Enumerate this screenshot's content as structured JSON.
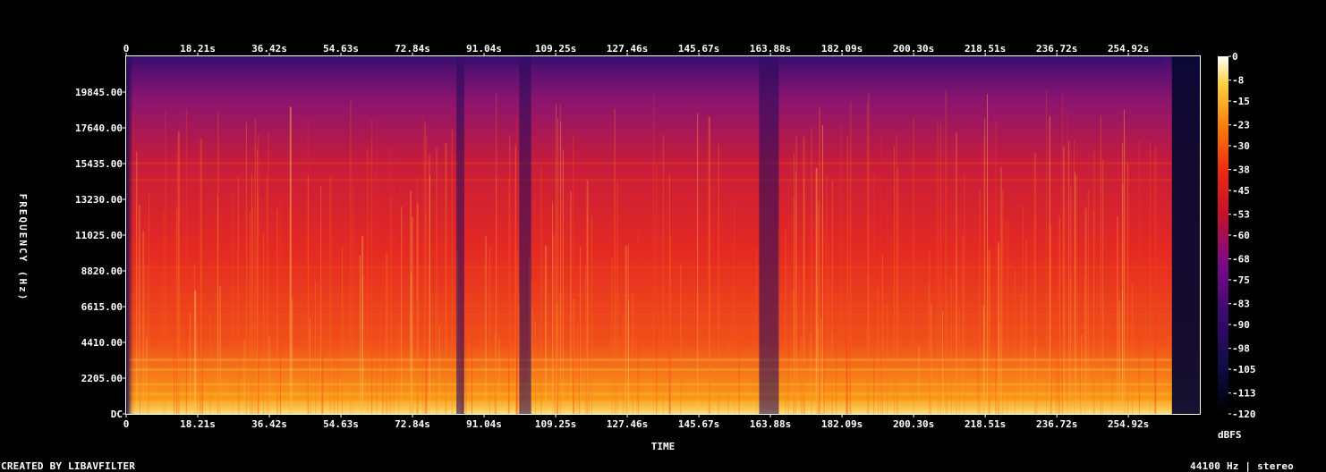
{
  "chart_data": {
    "type": "heatmap",
    "title": "",
    "xlabel": "TIME",
    "ylabel": "FREQUENCY (Hz)",
    "colorbar_label": "dBFS",
    "x_ticks": [
      "0",
      "18.21s",
      "36.42s",
      "54.63s",
      "72.84s",
      "91.04s",
      "109.25s",
      "127.46s",
      "145.67s",
      "163.88s",
      "182.09s",
      "200.30s",
      "218.51s",
      "236.72s",
      "254.92s"
    ],
    "x_tick_values": [
      0,
      18.21,
      36.42,
      54.63,
      72.84,
      91.04,
      109.25,
      127.46,
      145.67,
      163.88,
      182.09,
      200.3,
      218.51,
      236.72,
      254.92
    ],
    "xlim": [
      0,
      273.1
    ],
    "y_ticks": [
      "DC",
      "2205.00",
      "4410.00",
      "6615.00",
      "8820.00",
      "11025.00",
      "13230.00",
      "15435.00",
      "17640.00",
      "19845.00"
    ],
    "y_tick_values": [
      0,
      2205,
      4410,
      6615,
      8820,
      11025,
      13230,
      15435,
      17640,
      19845
    ],
    "ylim": [
      0,
      22050
    ],
    "colorbar_ticks": [
      "0",
      "-8",
      "-15",
      "-23",
      "-30",
      "-38",
      "-45",
      "-53",
      "-60",
      "-68",
      "-75",
      "-83",
      "-90",
      "-98",
      "-105",
      "-113",
      "-120"
    ],
    "colorbar_values": [
      0,
      -8,
      -15,
      -23,
      -30,
      -38,
      -45,
      -53,
      -60,
      -68,
      -75,
      -83,
      -90,
      -98,
      -105,
      -113,
      -120
    ],
    "colorbar_range": [
      -120,
      0
    ],
    "colormap": "intensity (black-blue-purple-red-orange-yellow-white)",
    "quiet_segments_s": [
      [
        84.0,
        86.0
      ],
      [
        100.0,
        103.0
      ],
      [
        161.0,
        166.0
      ],
      [
        266.0,
        273.1
      ]
    ],
    "colors": {
      "background": "#000000",
      "text": "#ffffff",
      "colormap_stops": [
        "#000000",
        "#0c0c40",
        "#3a0a6e",
        "#7a0a8a",
        "#c8102c",
        "#ee2a10",
        "#fa7a0c",
        "#fdd03a",
        "#ffffff"
      ]
    }
  },
  "footer": {
    "left": "CREATED BY LIBAVFILTER",
    "right": "44100 Hz | stereo"
  }
}
